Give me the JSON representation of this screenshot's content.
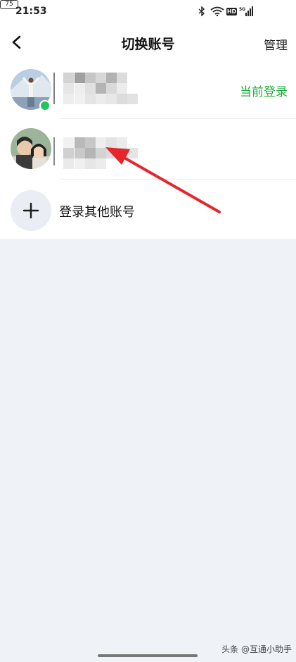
{
  "status_bar": {
    "time": "21:53",
    "hd_label": "HD",
    "network_label": "5G",
    "battery_level": "75"
  },
  "header": {
    "title": "切换账号",
    "manage_label": "管理"
  },
  "accounts": [
    {
      "status_label": "当前登录",
      "online": true
    },
    {
      "status_label": "",
      "online": false
    }
  ],
  "add_account": {
    "label": "登录其他账号"
  },
  "watermark": {
    "text": "头条 @互通小助手"
  },
  "colors": {
    "accent_green": "#1aad3a",
    "annotation_arrow": "#e5262c",
    "page_background": "#eff3f8"
  }
}
